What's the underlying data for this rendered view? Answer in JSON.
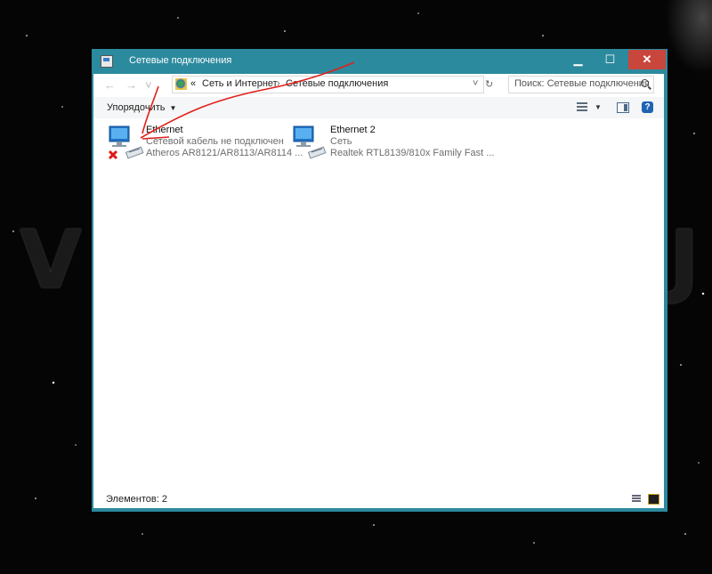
{
  "window": {
    "title": "Сетевые подключения",
    "controls": {
      "minimize": "▁",
      "maximize": "☐",
      "close": "✕"
    }
  },
  "nav": {
    "back": "←",
    "forward": "→",
    "recent": "˅",
    "refresh": "↻"
  },
  "address": {
    "prefix": "«",
    "segments": [
      "Сеть и Интернет",
      "Сетевые подключения"
    ],
    "separator": "›",
    "dropdown": "˅"
  },
  "search": {
    "placeholder": "Поиск: Сетевые подключения"
  },
  "toolbar": {
    "organize_label": "Упорядочить",
    "organize_arrow": "▼",
    "view_arrow": "▼",
    "help": "?"
  },
  "connections": [
    {
      "name": "Ethernet",
      "status": "Сетевой кабель не подключен",
      "adapter": "Atheros AR8121/AR8113/AR8114 ...",
      "disconnected": true
    },
    {
      "name": "Ethernet 2",
      "status": "Сеть",
      "adapter": "Realtek RTL8139/810x Family Fast ...",
      "disconnected": false
    }
  ],
  "statusbar": {
    "count_label": "Элементов: 2"
  },
  "colors": {
    "title_bar": "#2c8a9e",
    "close_button": "#c9463d",
    "annotation": "#e0201c",
    "secondary_text": "#6d6d6d"
  }
}
